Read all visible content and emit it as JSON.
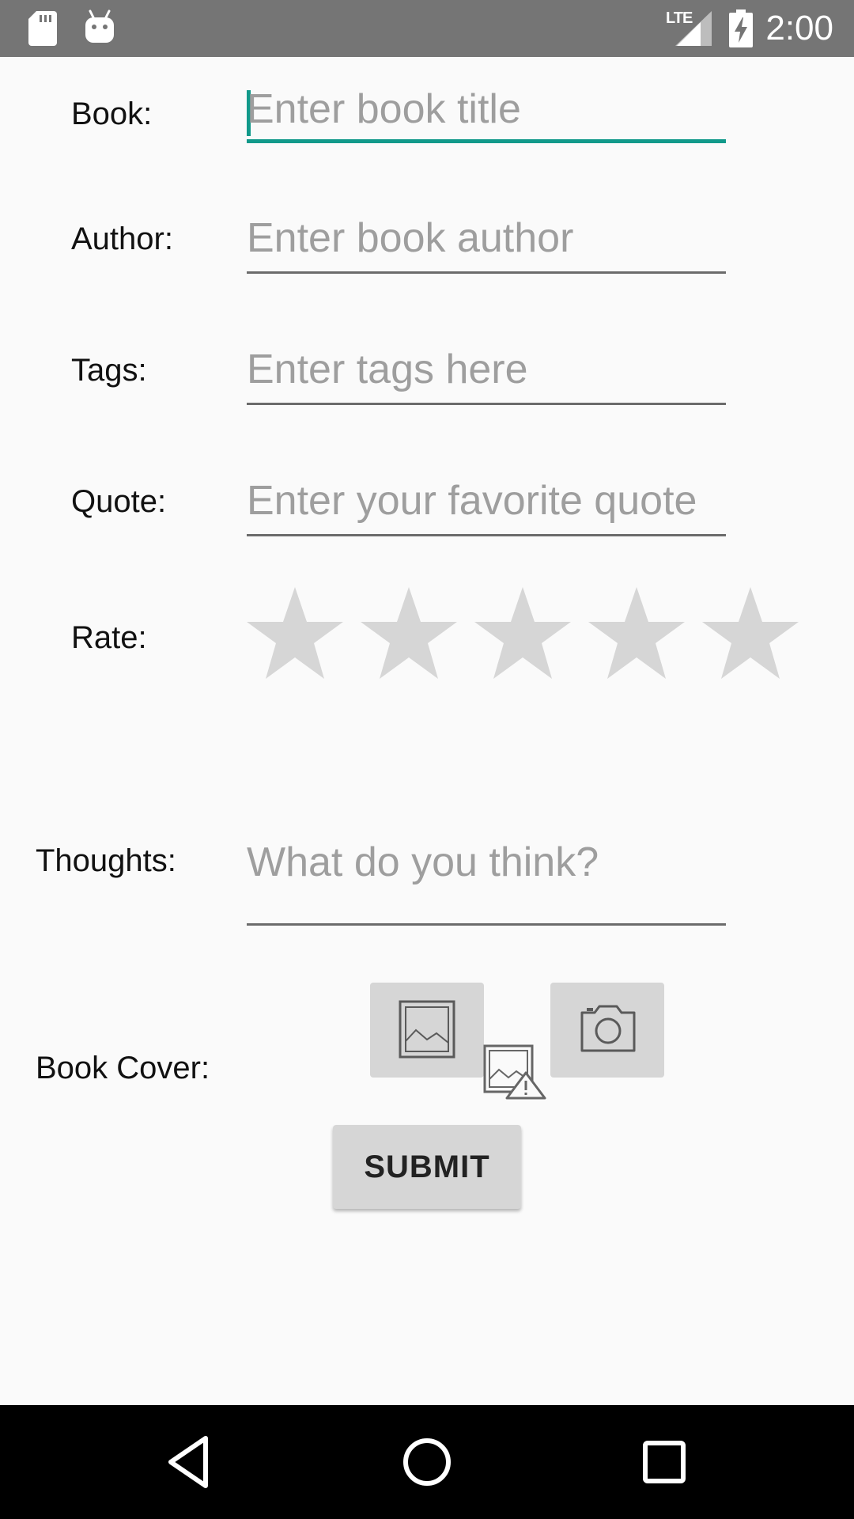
{
  "status_bar": {
    "time": "2:00",
    "network": "LTE",
    "icons": [
      "sd-card-icon",
      "android-icon",
      "signal-icon",
      "battery-charging-icon"
    ]
  },
  "form": {
    "book": {
      "label": "Book:",
      "placeholder": "Enter book title",
      "focused": true
    },
    "author": {
      "label": "Author:",
      "placeholder": "Enter book author"
    },
    "tags": {
      "label": "Tags:",
      "placeholder": "Enter tags here"
    },
    "quote": {
      "label": "Quote:",
      "placeholder": "Enter your favorite quote"
    },
    "rate": {
      "label": "Rate:",
      "max_stars": 5,
      "value": 0
    },
    "thoughts": {
      "label": "Thoughts:",
      "placeholder": "What do you think?"
    },
    "book_cover": {
      "label": "Book Cover:",
      "gallery_icon": "image-icon",
      "camera_icon": "camera-icon",
      "preview_icon": "broken-image-icon"
    },
    "submit_label": "SUBMIT"
  },
  "colors": {
    "accent": "#11998a",
    "status_bar": "#757575",
    "star_empty": "#d6d6d6",
    "placeholder": "#9e9e9e"
  }
}
